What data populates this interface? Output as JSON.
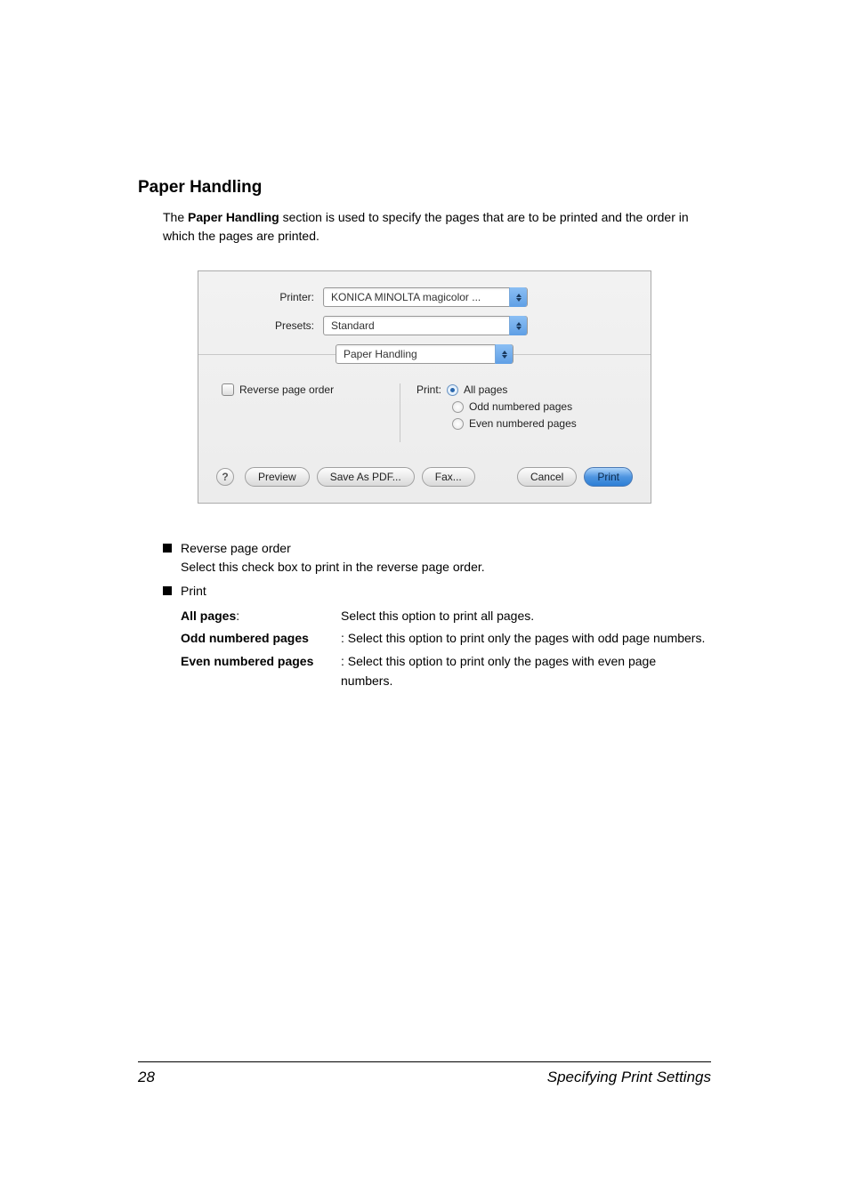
{
  "section": {
    "title": "Paper Handling",
    "intro_1": "The ",
    "intro_bold": "Paper Handling",
    "intro_2": " section is used to specify the pages that are to be printed and the order in which the pages are printed."
  },
  "dialog": {
    "printer_label": "Printer:",
    "printer_value": "KONICA MINOLTA magicolor ...",
    "presets_label": "Presets:",
    "presets_value": "Standard",
    "section_value": "Paper Handling",
    "reverse_label": "Reverse page order",
    "print_label": "Print:",
    "radio_all": "All pages",
    "radio_odd": "Odd numbered pages",
    "radio_even": "Even numbered pages",
    "help": "?",
    "btn_preview": "Preview",
    "btn_savepdf": "Save As PDF...",
    "btn_fax": "Fax...",
    "btn_cancel": "Cancel",
    "btn_print": "Print"
  },
  "bullets": {
    "reverse_title": "Reverse page order",
    "reverse_desc": "Select this check box to print in the reverse page order.",
    "print_title": "Print",
    "all_term": "All pages",
    "all_colon": ":",
    "all_desc": "Select this option to print all pages.",
    "odd_term": "Odd numbered pages",
    "odd_desc": ": Select this option to print only the pages with odd page numbers.",
    "even_term": "Even numbered pages",
    "even_desc": ": Select this option to print only the pages with even page numbers."
  },
  "footer": {
    "page_num": "28",
    "section_name": "Specifying Print Settings"
  }
}
